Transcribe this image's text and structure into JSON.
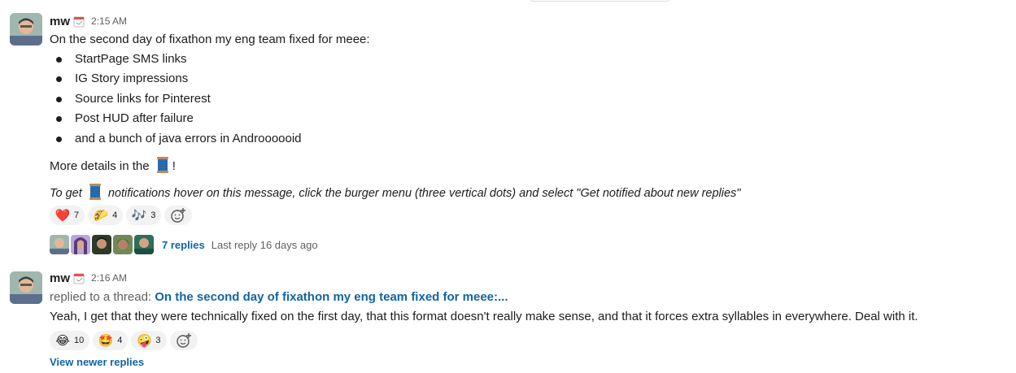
{
  "messages": [
    {
      "author": "mw",
      "time": "2:15 AM",
      "intro": "On the second day of fixathon my eng team fixed for meee:",
      "bullets": [
        "StartPage SMS links",
        "IG Story impressions",
        "Source links for Pinterest",
        "Post HUD after failure",
        "and a bunch of java errors in Androooooid"
      ],
      "details_before": "More details in the",
      "details_after": "!",
      "note_before": "To get",
      "note_after": "notifications hover on this message, click the burger menu (three vertical dots) and select \"Get notified about new replies\"",
      "reactions": [
        {
          "emoji": "❤️",
          "count": "7",
          "icon": "heart-emoji"
        },
        {
          "emoji": "🌮",
          "count": "4",
          "icon": "taco-emoji"
        },
        {
          "emoji": "🎶",
          "count": "3",
          "icon": "music-notes-emoji"
        }
      ],
      "thread": {
        "replies_label": "7 replies",
        "last_reply": "Last reply 16 days ago"
      }
    },
    {
      "author": "mw",
      "time": "2:16 AM",
      "replied_prefix": "replied to a thread:",
      "replied_link": "On the second day of fixathon my eng team fixed for meee:...",
      "body": "Yeah, I get that they were technically fixed on the first day, that this format doesn't really make sense, and that it forces extra syllables in everywhere. Deal with it.",
      "reactions": [
        {
          "emoji": "😂",
          "count": "10",
          "icon": "laughing-emoji"
        },
        {
          "emoji": "🤩",
          "count": "4",
          "icon": "star-struck-emoji"
        },
        {
          "emoji": "🤪",
          "count": "3",
          "icon": "zany-face-emoji"
        }
      ],
      "view_newer": "View newer replies"
    }
  ],
  "colors": {
    "link": "#1264a3",
    "muted": "#616061",
    "reaction_bg": "#f2f2f2"
  }
}
